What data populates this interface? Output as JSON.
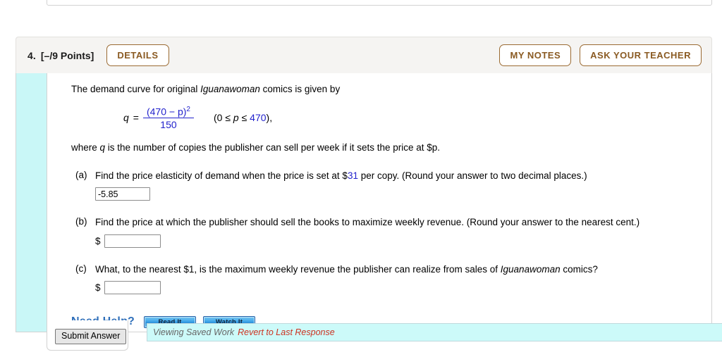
{
  "header": {
    "number": "4.",
    "points": "[–/9 Points]",
    "details_label": "DETAILS",
    "my_notes_label": "MY NOTES",
    "ask_teacher_label": "ASK YOUR TEACHER"
  },
  "problem": {
    "stem_before_italic": "The demand curve for original ",
    "stem_italic": "Iguanawoman",
    "stem_after_italic": " comics is given by",
    "equation": {
      "lhs": "q",
      "equals": "=",
      "numerator": "(470 − p)",
      "numerator_exponent": "2",
      "denominator": "150",
      "constraint": "(0 ≤ p ≤ 470),",
      "constraint_prefix": "(0 ≤ ",
      "constraint_var": "p",
      "constraint_mid": " ≤ ",
      "constraint_max": "470",
      "constraint_suffix": "),"
    },
    "where_prefix": "where ",
    "where_var": "q",
    "where_suffix": " is the number of copies the publisher can sell per week if it sets the price at $p."
  },
  "parts": [
    {
      "label": "(a)",
      "prompt_start": "Find the price elasticity of demand when the price is set at $",
      "prompt_value": "31",
      "prompt_end": " per copy. (Round your answer to two decimal places.)",
      "has_dollar": false,
      "value": "-5.85",
      "placeholder": ""
    },
    {
      "label": "(b)",
      "prompt_start": "Find the price at which the publisher should sell the books to maximize weekly revenue. (Round your answer to the nearest cent.)",
      "prompt_value": "",
      "prompt_end": "",
      "has_dollar": true,
      "dollar": "$",
      "value": "",
      "placeholder": ""
    },
    {
      "label": "(c)",
      "prompt_start": "What, to the nearest $1, is the maximum weekly revenue the publisher can realize from sales of ",
      "prompt_italic": "Iguanawoman",
      "prompt_end": " comics?",
      "has_dollar": true,
      "dollar": "$",
      "value": "",
      "placeholder": ""
    }
  ],
  "need_help": {
    "label": "Need Help?",
    "read_it": "Read It",
    "watch_it": "Watch It"
  },
  "footer": {
    "viewing_saved_work": "Viewing Saved Work",
    "revert_link": "Revert to Last Response",
    "submit_label": "Submit Answer"
  },
  "colors": {
    "accent_brown": "#8a5a22",
    "math_blue": "#2222cc",
    "need_help_blue": "#2f6fba",
    "cyan_strip": "#c9f7f7",
    "saved_bar": "#ccfaf9",
    "revert_red": "#cc3322"
  }
}
